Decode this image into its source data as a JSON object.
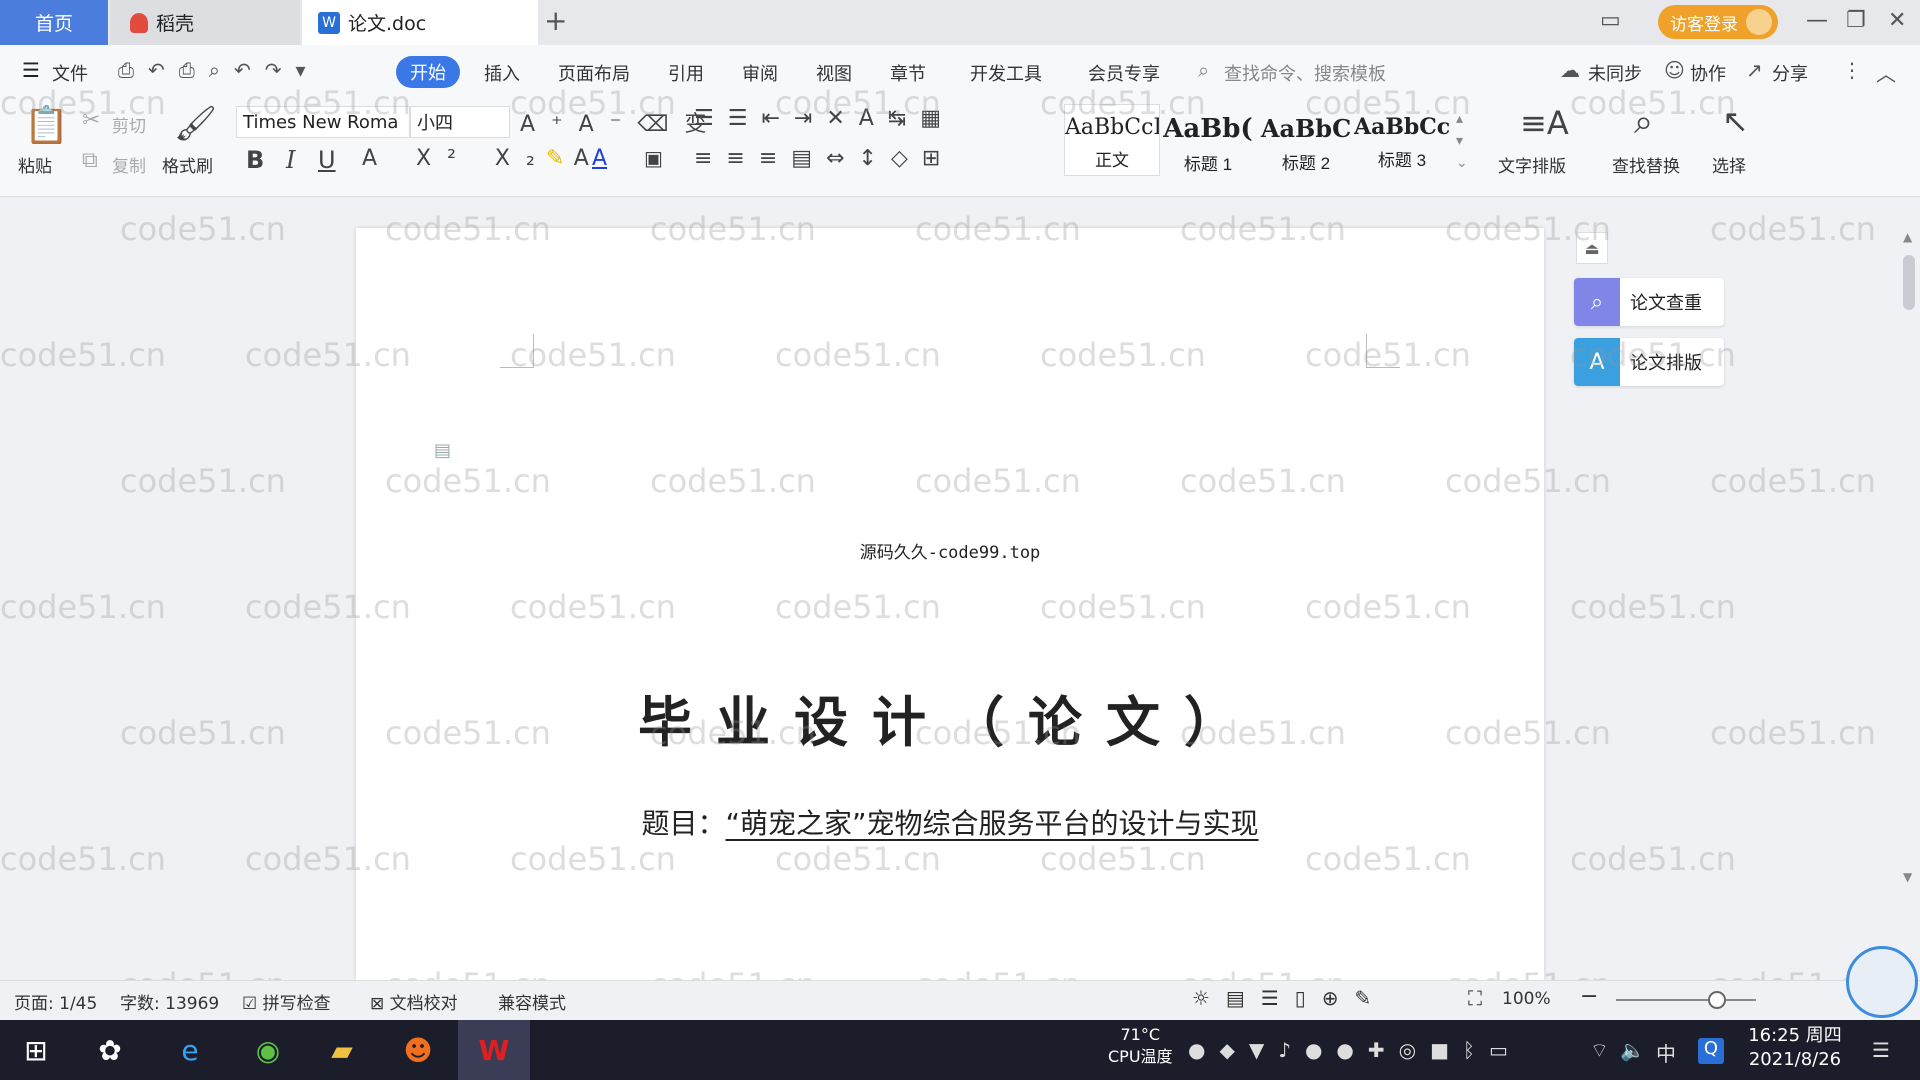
{
  "tabs": {
    "home": "首页",
    "daoke": "稻壳",
    "doc": "论文.doc",
    "new_tab": "+"
  },
  "header": {
    "login": "访客登录"
  },
  "menu": {
    "file": "文件",
    "items": [
      "开始",
      "插入",
      "页面布局",
      "引用",
      "审阅",
      "视图",
      "章节",
      "开发工具",
      "会员专享"
    ],
    "search_placeholder": "查找命令、搜索模板",
    "unsynced": "未同步",
    "collab": "协作",
    "share": "分享"
  },
  "ribbon": {
    "paste": "粘贴",
    "cut": "剪切",
    "copy": "复制",
    "format_painter": "格式刷",
    "font_name": "Times New Roma",
    "font_size": "小四",
    "styles": [
      {
        "sample": "AaBbCcI",
        "name": "正文"
      },
      {
        "sample": "AaBb(",
        "name": "标题 1"
      },
      {
        "sample": "AaBbC",
        "name": "标题 2"
      },
      {
        "sample": "AaBbCcl",
        "name": "标题 3"
      }
    ],
    "text_layout": "文字排版",
    "find_replace": "查找替换",
    "select": "选择"
  },
  "document": {
    "source_line": "源码久久-code99.top",
    "title": "毕业设计（论文）",
    "subject_label": "题目：",
    "subject_value": "“萌宠之家”宠物综合服务平台的设计与实现"
  },
  "side_panel": {
    "check": "论文查重",
    "format": "论文排版"
  },
  "status": {
    "page": "页面: 1/45",
    "words": "字数: 13969",
    "spell": "拼写检查",
    "proof": "文档校对",
    "compat": "兼容模式",
    "zoom": "100%"
  },
  "taskbar": {
    "cpu_temp": "71°C",
    "cpu_label": "CPU温度",
    "ime": "中",
    "time": "16:25 周四",
    "date": "2021/8/26"
  },
  "watermark": "code51.cn",
  "colors": {
    "accent": "#3b78e7",
    "home_tab": "#4a7ddd",
    "login": "#f0a12a",
    "taskbar": "#1b1d2b"
  }
}
